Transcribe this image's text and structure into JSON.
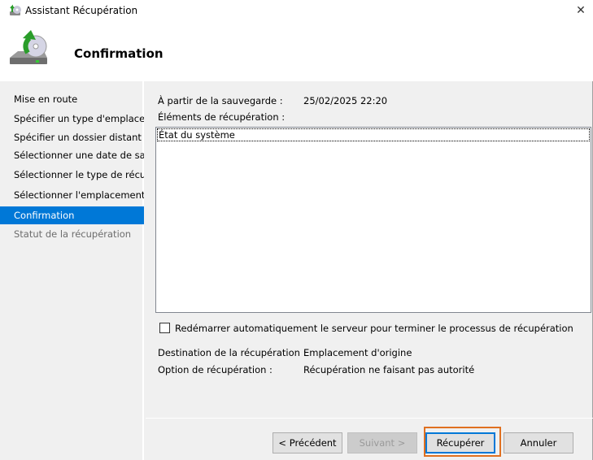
{
  "window": {
    "title": "Assistant Récupération",
    "close_glyph": "✕"
  },
  "header": {
    "heading": "Confirmation"
  },
  "sidebar": {
    "items": [
      {
        "label": "Mise en route",
        "state": "normal"
      },
      {
        "label": "Spécifier un type d'emplacement",
        "state": "normal"
      },
      {
        "label": "Spécifier un dossier distant",
        "state": "normal"
      },
      {
        "label": "Sélectionner une date de sauvegarde",
        "state": "normal"
      },
      {
        "label": "Sélectionner le type de récupération",
        "state": "normal"
      },
      {
        "label": "Sélectionner l'emplacement",
        "state": "normal"
      },
      {
        "label": "Confirmation",
        "state": "active"
      },
      {
        "label": "Statut de la récupération",
        "state": "disabled"
      }
    ]
  },
  "main": {
    "backup_label": "À partir de la sauvegarde :",
    "backup_value": "25/02/2025 22:20",
    "items_label": "Éléments de récupération :",
    "items": [
      "État du système"
    ],
    "restart_checkbox": {
      "label": "Redémarrer automatiquement le serveur pour terminer le processus de récupération",
      "checked": false
    },
    "destination_label": "Destination de la récupération :",
    "destination_value": "Emplacement d'origine",
    "option_label": "Option de récupération :",
    "option_value": "Récupération ne faisant pas autorité"
  },
  "buttons": {
    "previous": "< Précédent",
    "next": "Suivant >",
    "recover": "Récupérer",
    "cancel": "Annuler"
  },
  "colors": {
    "selection": "#0078d7",
    "highlight": "#e07020"
  }
}
